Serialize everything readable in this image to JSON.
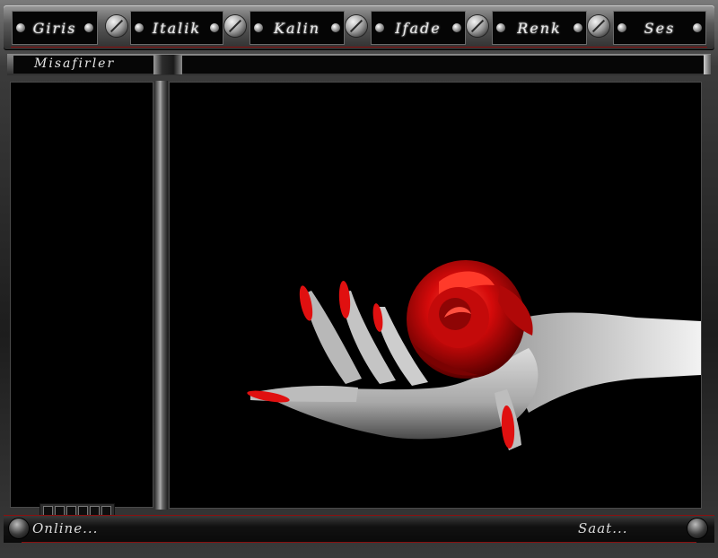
{
  "toolbar": {
    "buttons": [
      {
        "label": "Giris"
      },
      {
        "label": "Italik"
      },
      {
        "label": "Kalin"
      },
      {
        "label": "Ifade"
      },
      {
        "label": "Renk"
      },
      {
        "label": "Ses"
      }
    ]
  },
  "sidebar": {
    "title": "Misafirler"
  },
  "footer": {
    "online_label": "Online...",
    "clock_label": "Saat..."
  },
  "colors": {
    "accent": "#d40a0a",
    "background": "#000000",
    "chrome": "#6e6e6e"
  }
}
